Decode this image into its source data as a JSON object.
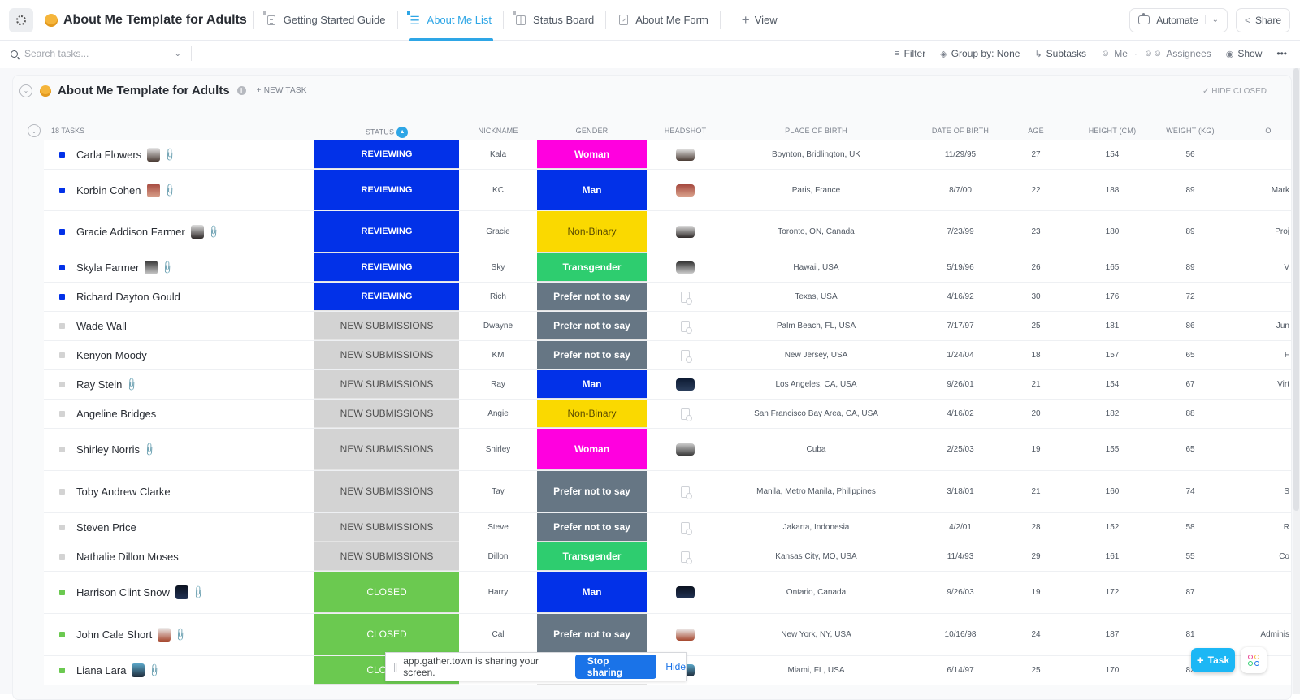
{
  "header": {
    "app_title": "About Me Template for Adults",
    "tabs": [
      {
        "label": "Getting Started Guide",
        "icon": "doc-icon",
        "pinned": true,
        "active": false
      },
      {
        "label": "About Me List",
        "icon": "list-icon",
        "pinned": true,
        "active": true
      },
      {
        "label": "Status Board",
        "icon": "board-icon",
        "pinned": true,
        "active": false
      },
      {
        "label": "About Me Form",
        "icon": "form-icon",
        "pinned": false,
        "active": false
      }
    ],
    "add_view_label": "View",
    "automate_label": "Automate",
    "share_label": "Share"
  },
  "toolbar": {
    "search_placeholder": "Search tasks...",
    "filter_label": "Filter",
    "group_by_label": "Group by: None",
    "subtasks_label": "Subtasks",
    "me_label": "Me",
    "assignees_label": "Assignees",
    "show_label": "Show",
    "more_label": "•••"
  },
  "list": {
    "title": "About Me Template for Adults",
    "new_task_label": "+ NEW TASK",
    "hide_closed_label": "HIDE CLOSED",
    "task_count_label": "18 TASKS",
    "columns": {
      "status": "STATUS",
      "nickname": "NICKNAME",
      "gender": "GENDER",
      "headshot": "HEADSHOT",
      "place_of_birth": "PLACE OF BIRTH",
      "date_of_birth": "DATE OF BIRTH",
      "age": "AGE",
      "height": "HEIGHT (CM)",
      "weight": "WEIGHT (KG)",
      "occupation": "O"
    },
    "status_colors": {
      "REVIEWING": "#0231e8",
      "NEW SUBMISSIONS": "#d3d3d3",
      "CLOSED": "#6bc950"
    },
    "gender_colors": {
      "Woman": "#ff00df",
      "Man": "#0231e8",
      "Non-Binary": "#fad900",
      "Transgender": "#2ecd6f",
      "Prefer not to say": "#667684"
    },
    "rows": [
      {
        "name": "Carla Flowers",
        "thumb": true,
        "attach": true,
        "status": "REVIEWING",
        "nickname": "Kala",
        "gender": "Woman",
        "headshot": "photo",
        "place": "Boynton, Bridlington, UK",
        "dob": "11/29/95",
        "age": "27",
        "height": "154",
        "weight": "56",
        "occupation": ""
      },
      {
        "name": "Korbin Cohen",
        "thumb": true,
        "attach": true,
        "status": "REVIEWING",
        "nickname": "KC",
        "gender": "Man",
        "headshot": "photo",
        "place": "Paris, France",
        "dob": "8/7/00",
        "age": "22",
        "height": "188",
        "weight": "89",
        "occupation": "Mark"
      },
      {
        "name": "Gracie Addison Farmer",
        "thumb": true,
        "attach": true,
        "status": "REVIEWING",
        "nickname": "Gracie",
        "gender": "Non-Binary",
        "headshot": "photo",
        "place": "Toronto, ON, Canada",
        "dob": "7/23/99",
        "age": "23",
        "height": "180",
        "weight": "89",
        "occupation": "Proj"
      },
      {
        "name": "Skyla Farmer",
        "thumb": true,
        "attach": true,
        "status": "REVIEWING",
        "nickname": "Sky",
        "gender": "Transgender",
        "headshot": "photo",
        "place": "Hawaii, USA",
        "dob": "5/19/96",
        "age": "26",
        "height": "165",
        "weight": "89",
        "occupation": "V"
      },
      {
        "name": "Richard Dayton Gould",
        "thumb": false,
        "attach": false,
        "status": "REVIEWING",
        "nickname": "Rich",
        "gender": "Prefer not to say",
        "headshot": "file",
        "place": "Texas, USA",
        "dob": "4/16/92",
        "age": "30",
        "height": "176",
        "weight": "72",
        "occupation": ""
      },
      {
        "name": "Wade Wall",
        "thumb": false,
        "attach": false,
        "status": "NEW SUBMISSIONS",
        "nickname": "Dwayne",
        "gender": "Prefer not to say",
        "headshot": "file",
        "place": "Palm Beach, FL, USA",
        "dob": "7/17/97",
        "age": "25",
        "height": "181",
        "weight": "86",
        "occupation": "Jun"
      },
      {
        "name": "Kenyon Moody",
        "thumb": false,
        "attach": false,
        "status": "NEW SUBMISSIONS",
        "nickname": "KM",
        "gender": "Prefer not to say",
        "headshot": "file",
        "place": "New Jersey, USA",
        "dob": "1/24/04",
        "age": "18",
        "height": "157",
        "weight": "65",
        "occupation": "F"
      },
      {
        "name": "Ray Stein",
        "thumb": false,
        "attach": true,
        "status": "NEW SUBMISSIONS",
        "nickname": "Ray",
        "gender": "Man",
        "headshot": "photo",
        "place": "Los Angeles, CA, USA",
        "dob": "9/26/01",
        "age": "21",
        "height": "154",
        "weight": "67",
        "occupation": "Virt"
      },
      {
        "name": "Angeline Bridges",
        "thumb": false,
        "attach": false,
        "status": "NEW SUBMISSIONS",
        "nickname": "Angie",
        "gender": "Non-Binary",
        "headshot": "file",
        "place": "San Francisco Bay Area, CA, USA",
        "dob": "4/16/02",
        "age": "20",
        "height": "182",
        "weight": "88",
        "occupation": ""
      },
      {
        "name": "Shirley Norris",
        "thumb": false,
        "attach": true,
        "status": "NEW SUBMISSIONS",
        "nickname": "Shirley",
        "gender": "Woman",
        "headshot": "photo",
        "place": "Cuba",
        "dob": "2/25/03",
        "age": "19",
        "height": "155",
        "weight": "65",
        "occupation": ""
      },
      {
        "name": "Toby Andrew Clarke",
        "thumb": false,
        "attach": false,
        "status": "NEW SUBMISSIONS",
        "nickname": "Tay",
        "gender": "Prefer not to say",
        "headshot": "file",
        "place": "Manila, Metro Manila, Philippines",
        "dob": "3/18/01",
        "age": "21",
        "height": "160",
        "weight": "74",
        "occupation": "S"
      },
      {
        "name": "Steven Price",
        "thumb": false,
        "attach": false,
        "status": "NEW SUBMISSIONS",
        "nickname": "Steve",
        "gender": "Prefer not to say",
        "headshot": "file",
        "place": "Jakarta, Indonesia",
        "dob": "4/2/01",
        "age": "28",
        "height": "152",
        "weight": "58",
        "occupation": "R"
      },
      {
        "name": "Nathalie Dillon Moses",
        "thumb": false,
        "attach": false,
        "status": "NEW SUBMISSIONS",
        "nickname": "Dillon",
        "gender": "Transgender",
        "headshot": "file",
        "place": "Kansas City, MO, USA",
        "dob": "11/4/93",
        "age": "29",
        "height": "161",
        "weight": "55",
        "occupation": "Co"
      },
      {
        "name": "Harrison Clint Snow",
        "thumb": true,
        "attach": true,
        "status": "CLOSED",
        "nickname": "Harry",
        "gender": "Man",
        "headshot": "photo",
        "place": "Ontario, Canada",
        "dob": "9/26/03",
        "age": "19",
        "height": "172",
        "weight": "87",
        "occupation": ""
      },
      {
        "name": "John Cale Short",
        "thumb": true,
        "attach": true,
        "status": "CLOSED",
        "nickname": "Cal",
        "gender": "Prefer not to say",
        "headshot": "photo",
        "place": "New York, NY, USA",
        "dob": "10/16/98",
        "age": "24",
        "height": "187",
        "weight": "81",
        "occupation": "Adminis"
      },
      {
        "name": "Liana Lara",
        "thumb": true,
        "attach": true,
        "status": "CLOSED",
        "nickname": "",
        "gender": "",
        "headshot": "photo",
        "place": "Miami, FL, USA",
        "dob": "6/14/97",
        "age": "25",
        "height": "170",
        "weight": "82",
        "occupation": ""
      }
    ]
  },
  "screen_share": {
    "message": "app.gather.town is sharing your screen.",
    "stop_label": "Stop sharing",
    "hide_label": "Hide"
  },
  "fab": {
    "task_label": "Task"
  }
}
